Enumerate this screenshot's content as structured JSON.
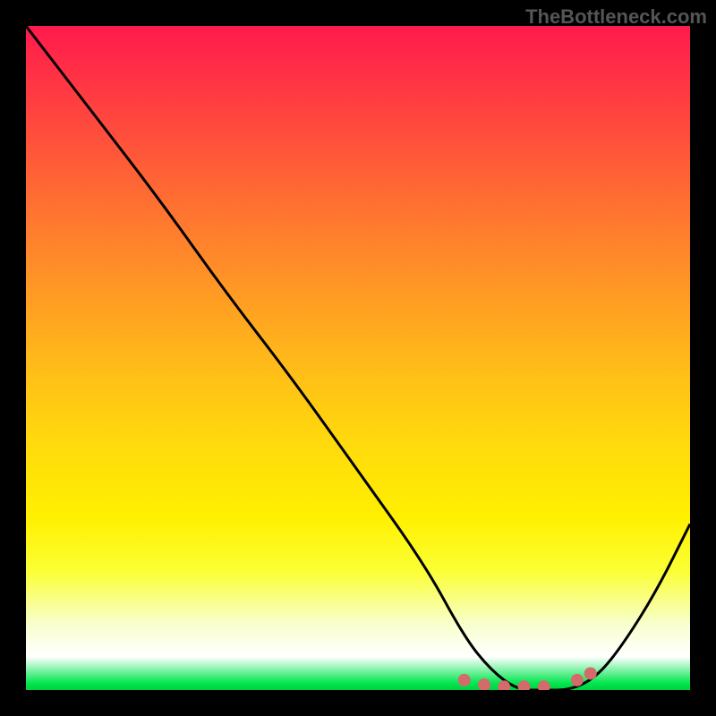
{
  "watermark": "TheBottleneck.com",
  "chart_data": {
    "type": "line",
    "title": "",
    "xlabel": "",
    "ylabel": "",
    "xlim": [
      0,
      100
    ],
    "ylim": [
      0,
      100
    ],
    "series": [
      {
        "name": "curve",
        "x": [
          0,
          10,
          20,
          30,
          40,
          50,
          60,
          66,
          70,
          74,
          78,
          82,
          86,
          90,
          95,
          100
        ],
        "values": [
          100,
          87,
          74,
          60,
          47,
          33,
          19,
          8,
          3,
          0,
          0,
          0,
          2,
          7,
          15,
          25
        ]
      }
    ],
    "markers": {
      "x": [
        66,
        69,
        72,
        75,
        78,
        83,
        85
      ],
      "values": [
        1.5,
        0.8,
        0.5,
        0.5,
        0.5,
        1.5,
        2.5
      ],
      "color": "#d46a6a"
    },
    "gradient_bands": [
      {
        "pos": 0,
        "color": "#ff1a4d"
      },
      {
        "pos": 50,
        "color": "#ffd80d"
      },
      {
        "pos": 95,
        "color": "#ffffff"
      },
      {
        "pos": 100,
        "color": "#00d040"
      }
    ]
  }
}
